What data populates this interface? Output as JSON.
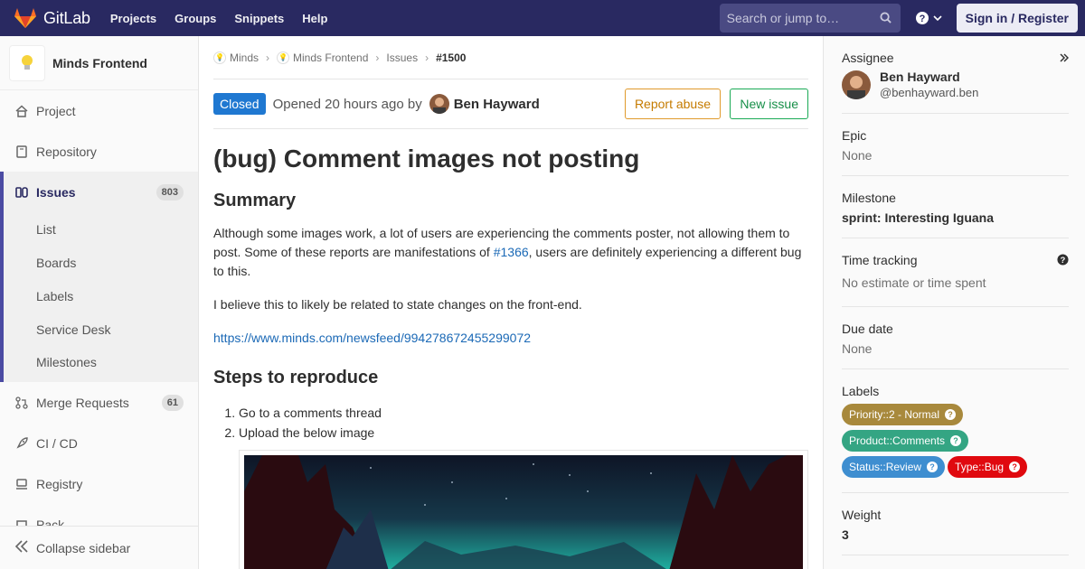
{
  "navbar": {
    "brand": "GitLab",
    "links": [
      "Projects",
      "Groups",
      "Snippets",
      "Help"
    ],
    "search_placeholder": "Search or jump to…",
    "signin_label": "Sign in / Register"
  },
  "sidebar": {
    "project_name": "Minds Frontend",
    "items": {
      "project": "Project",
      "repository": "Repository",
      "issues": "Issues",
      "issues_count": "803",
      "merge_requests": "Merge Requests",
      "merge_requests_count": "61",
      "cicd": "CI / CD",
      "registry": "Registry",
      "partial": "Pack"
    },
    "sub_items": [
      "List",
      "Boards",
      "Labels",
      "Service Desk",
      "Milestones"
    ],
    "collapse_label": "Collapse sidebar"
  },
  "breadcrumb": {
    "group": "Minds",
    "project": "Minds Frontend",
    "section": "Issues",
    "current": "#1500"
  },
  "issue": {
    "status": "Closed",
    "opened_text": "Opened 20 hours ago by",
    "author": "Ben Hayward",
    "report_abuse": "Report abuse",
    "new_issue": "New issue",
    "title": "(bug) Comment images not posting",
    "summary_heading": "Summary",
    "summary_p1_before": "Although some images work, a lot of users are experiencing the comments poster, not allowing them to post. Some of these reports are manifestations of ",
    "summary_p1_link": "#1366",
    "summary_p1_after": ", users are definitely experiencing a different bug to this.",
    "summary_p2": "I believe this to likely be related to state changes on the front-end.",
    "link_url": "https://www.minds.com/newsfeed/994278672455299072",
    "steps_heading": "Steps to reproduce",
    "steps": [
      "Go to a comments thread",
      "Upload the below image"
    ]
  },
  "right_sidebar": {
    "assignee_label": "Assignee",
    "assignee_name": "Ben Hayward",
    "assignee_handle": "@benhayward.ben",
    "epic_label": "Epic",
    "epic_value": "None",
    "milestone_label": "Milestone",
    "milestone_value": "sprint: Interesting Iguana",
    "time_label": "Time tracking",
    "time_value": "No estimate or time spent",
    "due_label": "Due date",
    "due_value": "None",
    "labels_label": "Labels",
    "labels": [
      {
        "text": "Priority::2 - Normal",
        "color": "#a8893c"
      },
      {
        "text": "Product::Comments",
        "color": "#34a583"
      },
      {
        "text": "Status::Review",
        "color": "#3e8ed0"
      },
      {
        "text": "Type::Bug",
        "color": "#e0090f"
      }
    ],
    "weight_label": "Weight",
    "weight_value": "3"
  },
  "colors": {
    "navbar": "#292961",
    "closed_badge": "#1f78d1",
    "link": "#1b69b6",
    "report_abuse": "#e09a2c",
    "new_issue": "#1aaa55"
  }
}
